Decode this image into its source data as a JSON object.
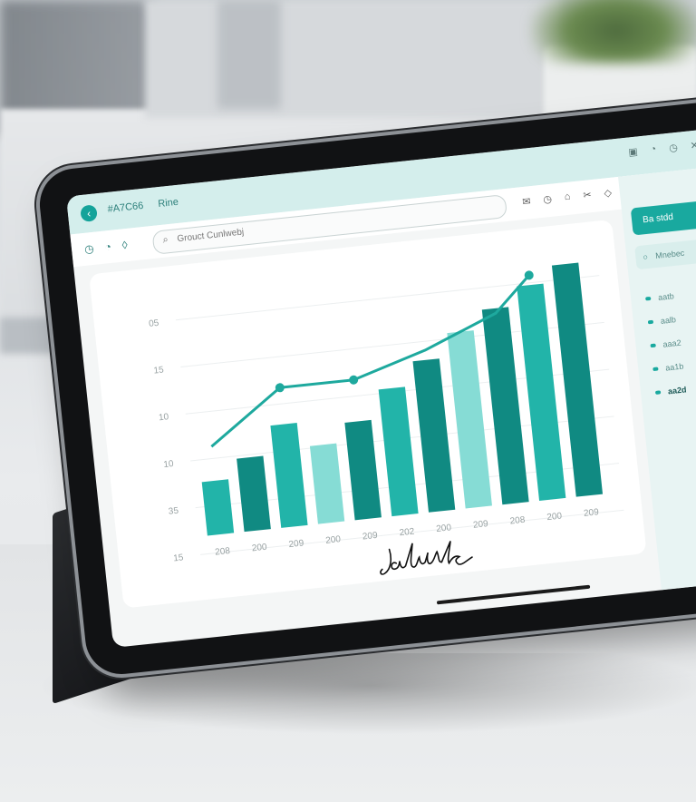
{
  "colors": {
    "accent": "#14a39a",
    "bar_dark": "#108a82",
    "bar_mid": "#22b4a9",
    "bar_light": "#86dcd5",
    "line": "#1ea99e",
    "topbar_bg": "#d4eeec",
    "panel_bg": "#e8f4f3"
  },
  "topbar": {
    "id_text": "#A7C66",
    "name_text": "Rine",
    "icons": [
      "calendar-icon",
      "bell-icon",
      "clock-icon",
      "close-icon"
    ]
  },
  "toolbar": {
    "left_icons": [
      "clock-icon",
      "bell-icon",
      "pin-icon"
    ],
    "search_placeholder": "Grouct Cunlwebj",
    "right_icons": [
      "mail-icon",
      "clock-icon",
      "bookmark-icon",
      "cut-icon",
      "tag-icon"
    ]
  },
  "side_panel": {
    "button_label": "Ba stdd",
    "filter_label": "Mnebec",
    "items": [
      "aatb",
      "aalb",
      "aaa2",
      "aa1b",
      "aa2d"
    ]
  },
  "chart_data": {
    "type": "bar",
    "title": "",
    "xlabel": "",
    "ylabel": "",
    "y_tick_labels": [
      "05",
      "15",
      "10",
      "10",
      "35",
      "15"
    ],
    "x_tick_labels": [
      "208",
      "200",
      "209",
      "200",
      "209",
      "202",
      "200",
      "209",
      "208",
      "200",
      "209"
    ],
    "bars": [
      {
        "value": 0.22,
        "shade": "mid"
      },
      {
        "value": 0.3,
        "shade": "dark"
      },
      {
        "value": 0.42,
        "shade": "mid"
      },
      {
        "value": 0.32,
        "shade": "light"
      },
      {
        "value": 0.4,
        "shade": "dark"
      },
      {
        "value": 0.52,
        "shade": "mid"
      },
      {
        "value": 0.62,
        "shade": "dark"
      },
      {
        "value": 0.72,
        "shade": "light"
      },
      {
        "value": 0.8,
        "shade": "dark"
      },
      {
        "value": 0.88,
        "shade": "mid"
      },
      {
        "value": 0.95,
        "shade": "dark"
      }
    ],
    "line_points": [
      0.36,
      0.57,
      0.57,
      0.66,
      0.78,
      0.92
    ],
    "grid": true
  },
  "signature_text": "Jalnk",
  "home_indicator": true
}
